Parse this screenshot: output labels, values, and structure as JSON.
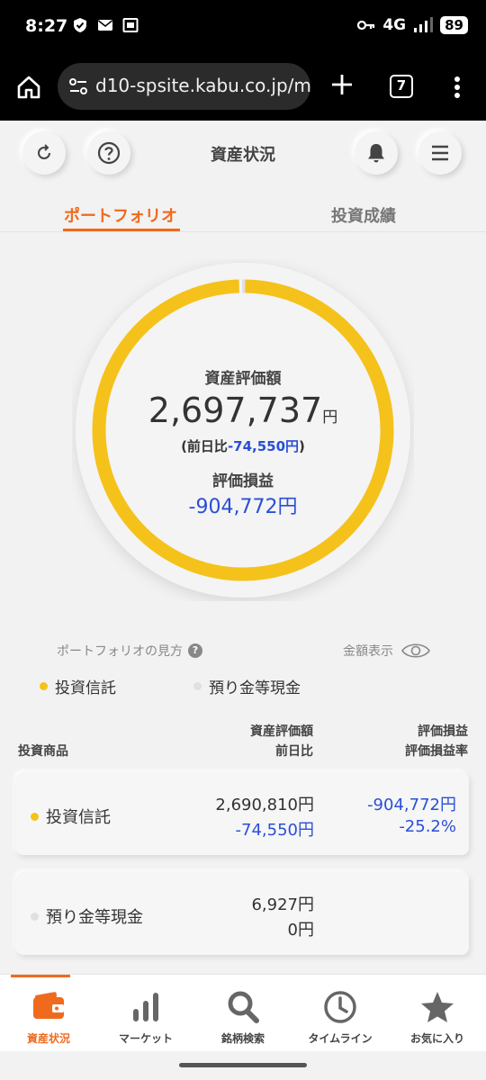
{
  "status_bar": {
    "time": "8:27",
    "network": "4G",
    "battery": "89"
  },
  "browser": {
    "url": "d10-spsite.kabu.co.jp/me",
    "tab_count": "7"
  },
  "header": {
    "title": "資産状況"
  },
  "tabs": [
    {
      "label": "ポートフォリオ",
      "active": true
    },
    {
      "label": "投資成績",
      "active": false
    }
  ],
  "summary": {
    "total_label": "資産評価額",
    "total_value": "2,697,737",
    "total_unit": "円",
    "diff_prefix": "(前日比",
    "diff_value": "-74,550円",
    "diff_suffix": ")",
    "pl_label": "評価損益",
    "pl_value": "-904,772円",
    "allocation": [
      {
        "name": "投資信託",
        "value": 2690810,
        "color": "#f5c21b"
      },
      {
        "name": "預り金等現金",
        "value": 6927,
        "color": "#e0e0e0"
      }
    ]
  },
  "legend_bar": {
    "howto_label": "ポートフォリオの見方",
    "amount_toggle_label": "金額表示"
  },
  "legend": [
    {
      "label": "投資信託",
      "color": "#f5c21b"
    },
    {
      "label": "預り金等現金",
      "color": "#e0e0e0"
    }
  ],
  "table_header": {
    "product": "投資商品",
    "value_line1": "資産評価額",
    "value_line2": "前日比",
    "pl_line1": "評価損益",
    "pl_line2": "評価損益率"
  },
  "rows": [
    {
      "name": "投資信託",
      "dot_color": "#f5c21b",
      "value": "2,690,810円",
      "diff": "-74,550円",
      "pl": "-904,772円",
      "pl_rate": "-25.2%"
    },
    {
      "name": "預り金等現金",
      "dot_color": "#e0e0e0",
      "value": "6,927円",
      "diff": "0円",
      "pl": "",
      "pl_rate": ""
    }
  ],
  "bottom_nav": [
    {
      "label": "資産状況",
      "icon": "wallet-icon",
      "active": true
    },
    {
      "label": "マーケット",
      "icon": "bar-chart-icon",
      "active": false
    },
    {
      "label": "銘柄検索",
      "icon": "search-icon",
      "active": false
    },
    {
      "label": "タイムライン",
      "icon": "clock-icon",
      "active": false
    },
    {
      "label": "お気に入り",
      "icon": "star-icon",
      "active": false
    }
  ]
}
